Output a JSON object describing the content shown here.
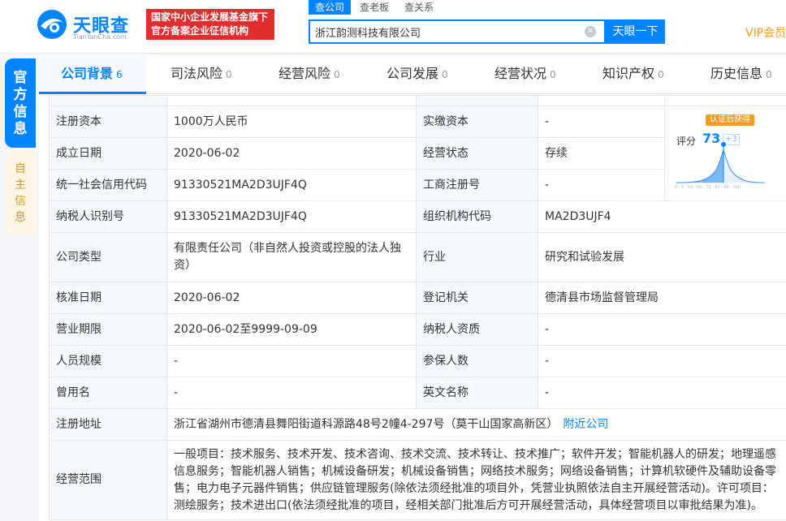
{
  "header": {
    "logo_title": "天眼查",
    "logo_sub": "TianYanCha.com",
    "slogan_line1": "国家中小企业发展基金旗下",
    "slogan_line2": "官方备案企业征信机构",
    "search_tabs": [
      "查公司",
      "查老板",
      "查关系"
    ],
    "search_value": "浙江韵测科技有限公司",
    "search_button": "天眼一下",
    "vip": "VIP会员"
  },
  "side_tabs": {
    "official": "官方信息",
    "self": "自主信息"
  },
  "nav": [
    {
      "label": "公司背景",
      "count": "6"
    },
    {
      "label": "司法风险",
      "count": "0"
    },
    {
      "label": "经营风险",
      "count": "0"
    },
    {
      "label": "公司发展",
      "count": "0"
    },
    {
      "label": "经营状况",
      "count": "0"
    },
    {
      "label": "知识产权",
      "count": "0"
    },
    {
      "label": "历史信息",
      "count": "0"
    }
  ],
  "score": {
    "badge": "认证后获得",
    "label": "评分",
    "value": "73",
    "plus": "+3"
  },
  "rows": {
    "reg_capital": {
      "label": "注册资本",
      "value": "1000万人民币"
    },
    "paid_capital": {
      "label": "实缴资本",
      "value": "-"
    },
    "found_date": {
      "label": "成立日期",
      "value": "2020-06-02"
    },
    "status": {
      "label": "经营状态",
      "value": "存续"
    },
    "credit_code": {
      "label": "统一社会信用代码",
      "value": "91330521MA2D3UJF4Q"
    },
    "biz_reg_no": {
      "label": "工商注册号",
      "value": "-"
    },
    "taxpayer_id": {
      "label": "纳税人识别号",
      "value": "91330521MA2D3UJF4Q"
    },
    "org_code": {
      "label": "组织机构代码",
      "value": "MA2D3UJF4"
    },
    "company_type": {
      "label": "公司类型",
      "value": "有限责任公司（非自然人投资或控股的法人独资）"
    },
    "industry": {
      "label": "行业",
      "value": "研究和试验发展"
    },
    "approve_date": {
      "label": "核准日期",
      "value": "2020-06-02"
    },
    "reg_authority": {
      "label": "登记机关",
      "value": "德清县市场监督管理局"
    },
    "biz_term": {
      "label": "营业期限",
      "value": "2020-06-02至9999-09-09"
    },
    "tax_qual": {
      "label": "纳税人资质",
      "value": "-"
    },
    "staff_size": {
      "label": "人员规模",
      "value": "-"
    },
    "insured": {
      "label": "参保人数",
      "value": "-"
    },
    "former_name": {
      "label": "曾用名",
      "value": "-"
    },
    "english_name": {
      "label": "英文名称",
      "value": "-"
    },
    "address": {
      "label": "注册地址",
      "value": "浙江省湖州市德清县舞阳街道科源路48号2幢4-297号（莫干山国家高新区）",
      "link": "附近公司"
    },
    "scope": {
      "label": "经营范围",
      "value": "一般项目：技术服务、技术开发、技术咨询、技术交流、技术转让、技术推广；软件开发；智能机器人的研发；地理遥感信息服务；智能机器人销售；机械设备研发；机械设备销售；网络技术服务；网络设备销售；计算机软硬件及辅助设备零售；电力电子元器件销售；供应链管理服务(除依法须经批准的项目外，凭营业执照依法自主开展经营活动)。许可项目：测绘服务；技术进出口(依法须经批准的项目，经相关部门批准后方可开展经营活动，具体经营项目以审批结果为准)。"
    }
  }
}
